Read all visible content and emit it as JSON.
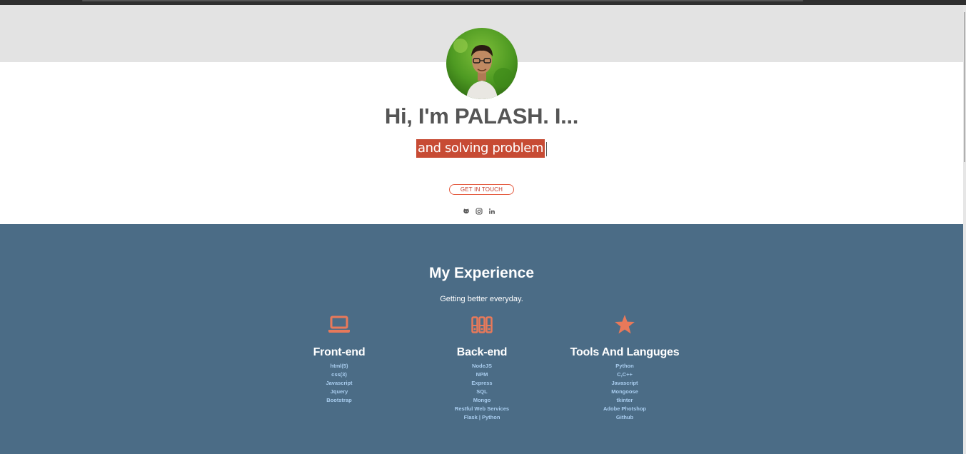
{
  "hero": {
    "headline": "Hi, I'm PALASH. I...",
    "typed_text": "and solving problem",
    "cta_label": "GET IN TOUCH"
  },
  "socials": [
    {
      "icon": "github-icon"
    },
    {
      "icon": "instagram-icon"
    },
    {
      "icon": "linkedin-icon"
    }
  ],
  "experience": {
    "title": "My Experience",
    "subtitle": "Getting better everyday.",
    "columns": [
      {
        "icon": "laptop-icon",
        "title": "Front-end",
        "items": [
          "html(5)",
          "css(3)",
          "Javascript",
          "Jquery",
          "Bootstrap"
        ]
      },
      {
        "icon": "server-icon",
        "title": "Back-end",
        "items": [
          "NodeJS",
          "NPM",
          "Express",
          "SQL",
          "Mongo",
          "Restful Web Services",
          "Flask | Python"
        ]
      },
      {
        "icon": "star-icon",
        "title": "Tools And Languges",
        "items": [
          "Python",
          "C,C++",
          "Javascript",
          "Mongoose",
          "tkinter",
          "Adobe Photshop",
          "Github"
        ]
      }
    ]
  },
  "colors": {
    "accent": "#e8795a",
    "section_bg": "#4b6c86",
    "highlight": "#c74b34",
    "link": "#a9cdef"
  }
}
